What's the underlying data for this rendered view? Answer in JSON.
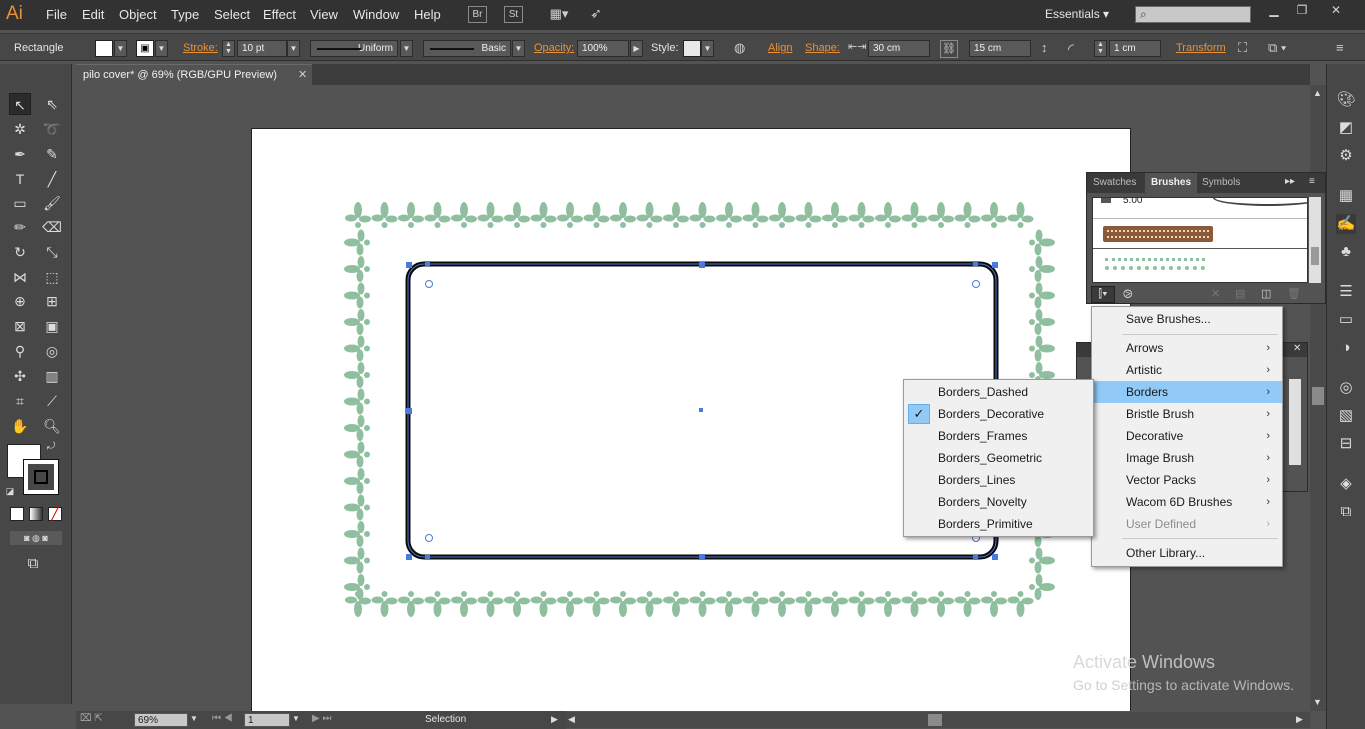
{
  "menubar": {
    "logo": "Ai",
    "items": [
      "File",
      "Edit",
      "Object",
      "Type",
      "Select",
      "Effect",
      "View",
      "Window",
      "Help"
    ],
    "bridge": "Br",
    "stock": "St",
    "workspace": "Essentials",
    "search_placeholder": ""
  },
  "controlbar": {
    "object_type": "Rectangle",
    "stroke_label": "Stroke:",
    "stroke_weight": "10 pt",
    "profile": "Uniform",
    "brush": "Basic",
    "opacity_label": "Opacity:",
    "opacity": "100%",
    "style_label": "Style:",
    "align_label": "Align",
    "shape_label": "Shape:",
    "width": "30 cm",
    "height": "15 cm",
    "corner": "1 cm",
    "transform_label": "Transform"
  },
  "document": {
    "tab_title": "pilo cover* @ 69% (RGB/GPU Preview)"
  },
  "statusbar": {
    "zoom": "69%",
    "artboard": "1",
    "tool": "Selection"
  },
  "brush_panel": {
    "tabs": [
      "Swatches",
      "Brushes",
      "Symbols"
    ],
    "active_tab": "Brushes",
    "brush_size": "5.00"
  },
  "library_menu": {
    "items": [
      {
        "label": "Save Brushes...",
        "submenu": false
      },
      {
        "label": "Arrows",
        "submenu": true
      },
      {
        "label": "Artistic",
        "submenu": true
      },
      {
        "label": "Borders",
        "submenu": true,
        "highlighted": true
      },
      {
        "label": "Bristle Brush",
        "submenu": true
      },
      {
        "label": "Decorative",
        "submenu": true
      },
      {
        "label": "Image Brush",
        "submenu": true
      },
      {
        "label": "Vector Packs",
        "submenu": true
      },
      {
        "label": "Wacom 6D Brushes",
        "submenu": true
      },
      {
        "label": "User Defined",
        "submenu": true,
        "disabled": true
      },
      {
        "label": "Other Library...",
        "submenu": false
      }
    ]
  },
  "borders_submenu": {
    "items": [
      {
        "label": "Borders_Dashed"
      },
      {
        "label": "Borders_Decorative",
        "checked": true
      },
      {
        "label": "Borders_Frames"
      },
      {
        "label": "Borders_Geometric"
      },
      {
        "label": "Borders_Lines"
      },
      {
        "label": "Borders_Novelty"
      },
      {
        "label": "Borders_Primitive"
      }
    ]
  },
  "watermark": {
    "title": "Activate Windows",
    "subtitle": "Go to Settings to activate Windows."
  },
  "colors": {
    "accent_orange": "#e8913a",
    "border_green": "#8fbf9f",
    "selection_blue": "#4a7bdc",
    "menu_highlight": "#91c9f7"
  }
}
